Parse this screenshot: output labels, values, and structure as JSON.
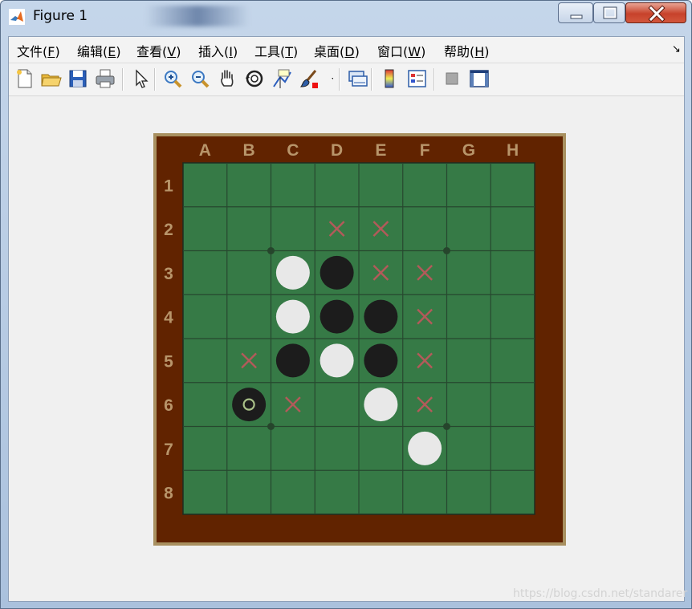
{
  "window": {
    "title": "Figure 1",
    "buttons": [
      "minimize",
      "maximize",
      "close"
    ]
  },
  "menubar": {
    "items": [
      {
        "label": "文件(",
        "key": "F",
        "end": ")"
      },
      {
        "label": "编辑(",
        "key": "E",
        "end": ")"
      },
      {
        "label": "查看(",
        "key": "V",
        "end": ")"
      },
      {
        "label": "插入(",
        "key": "I",
        "end": ")"
      },
      {
        "label": "工具(",
        "key": "T",
        "end": ")"
      },
      {
        "label": "桌面(",
        "key": "D",
        "end": ")"
      },
      {
        "label": "窗口(",
        "key": "W",
        "end": ")"
      },
      {
        "label": "帮助(",
        "key": "H",
        "end": ")"
      }
    ],
    "dock_icon": "dock-arrow-icon"
  },
  "toolbar": {
    "groups": [
      [
        "new-figure-icon",
        "open-file-icon",
        "save-icon",
        "print-icon"
      ],
      [
        "edit-plot-arrow-icon"
      ],
      [
        "zoom-in-icon",
        "zoom-out-icon",
        "pan-hand-icon",
        "rotate-3d-icon",
        "data-cursor-icon",
        "brush-icon",
        "brush-dropdown-icon"
      ],
      [
        "link-plot-icon"
      ],
      [
        "colorbar-icon",
        "legend-icon"
      ],
      [
        "hide-plot-tools-icon",
        "show-plot-tools-icon"
      ]
    ]
  },
  "board": {
    "columns": [
      "A",
      "B",
      "C",
      "D",
      "E",
      "F",
      "G",
      "H"
    ],
    "rows": [
      "1",
      "2",
      "3",
      "4",
      "5",
      "6",
      "7",
      "8"
    ],
    "colors": {
      "frame": "#612300",
      "frame_border": "#a89060",
      "felt": "#367a46",
      "grid": "#27482f",
      "label": "#b8956a",
      "black_piece": "#1c1c1c",
      "white_piece": "#e8e8e8",
      "marker": "#b35a5a",
      "last_move_ring": "#a9c088"
    },
    "pieces": [
      {
        "cell": "C3",
        "color": "white"
      },
      {
        "cell": "D3",
        "color": "black"
      },
      {
        "cell": "C4",
        "color": "white"
      },
      {
        "cell": "D4",
        "color": "black"
      },
      {
        "cell": "E4",
        "color": "black"
      },
      {
        "cell": "C5",
        "color": "black"
      },
      {
        "cell": "D5",
        "color": "white"
      },
      {
        "cell": "E5",
        "color": "black"
      },
      {
        "cell": "B6",
        "color": "black",
        "last_move": true
      },
      {
        "cell": "E6",
        "color": "white"
      },
      {
        "cell": "F7",
        "color": "white"
      }
    ],
    "valid_moves": [
      "D2",
      "E2",
      "E3",
      "F3",
      "F4",
      "B5",
      "F5",
      "C6",
      "F6"
    ],
    "star_points": [
      "C3",
      "G3",
      "C7",
      "G7"
    ]
  },
  "watermark": "https://blog.csdn.net/standarer"
}
